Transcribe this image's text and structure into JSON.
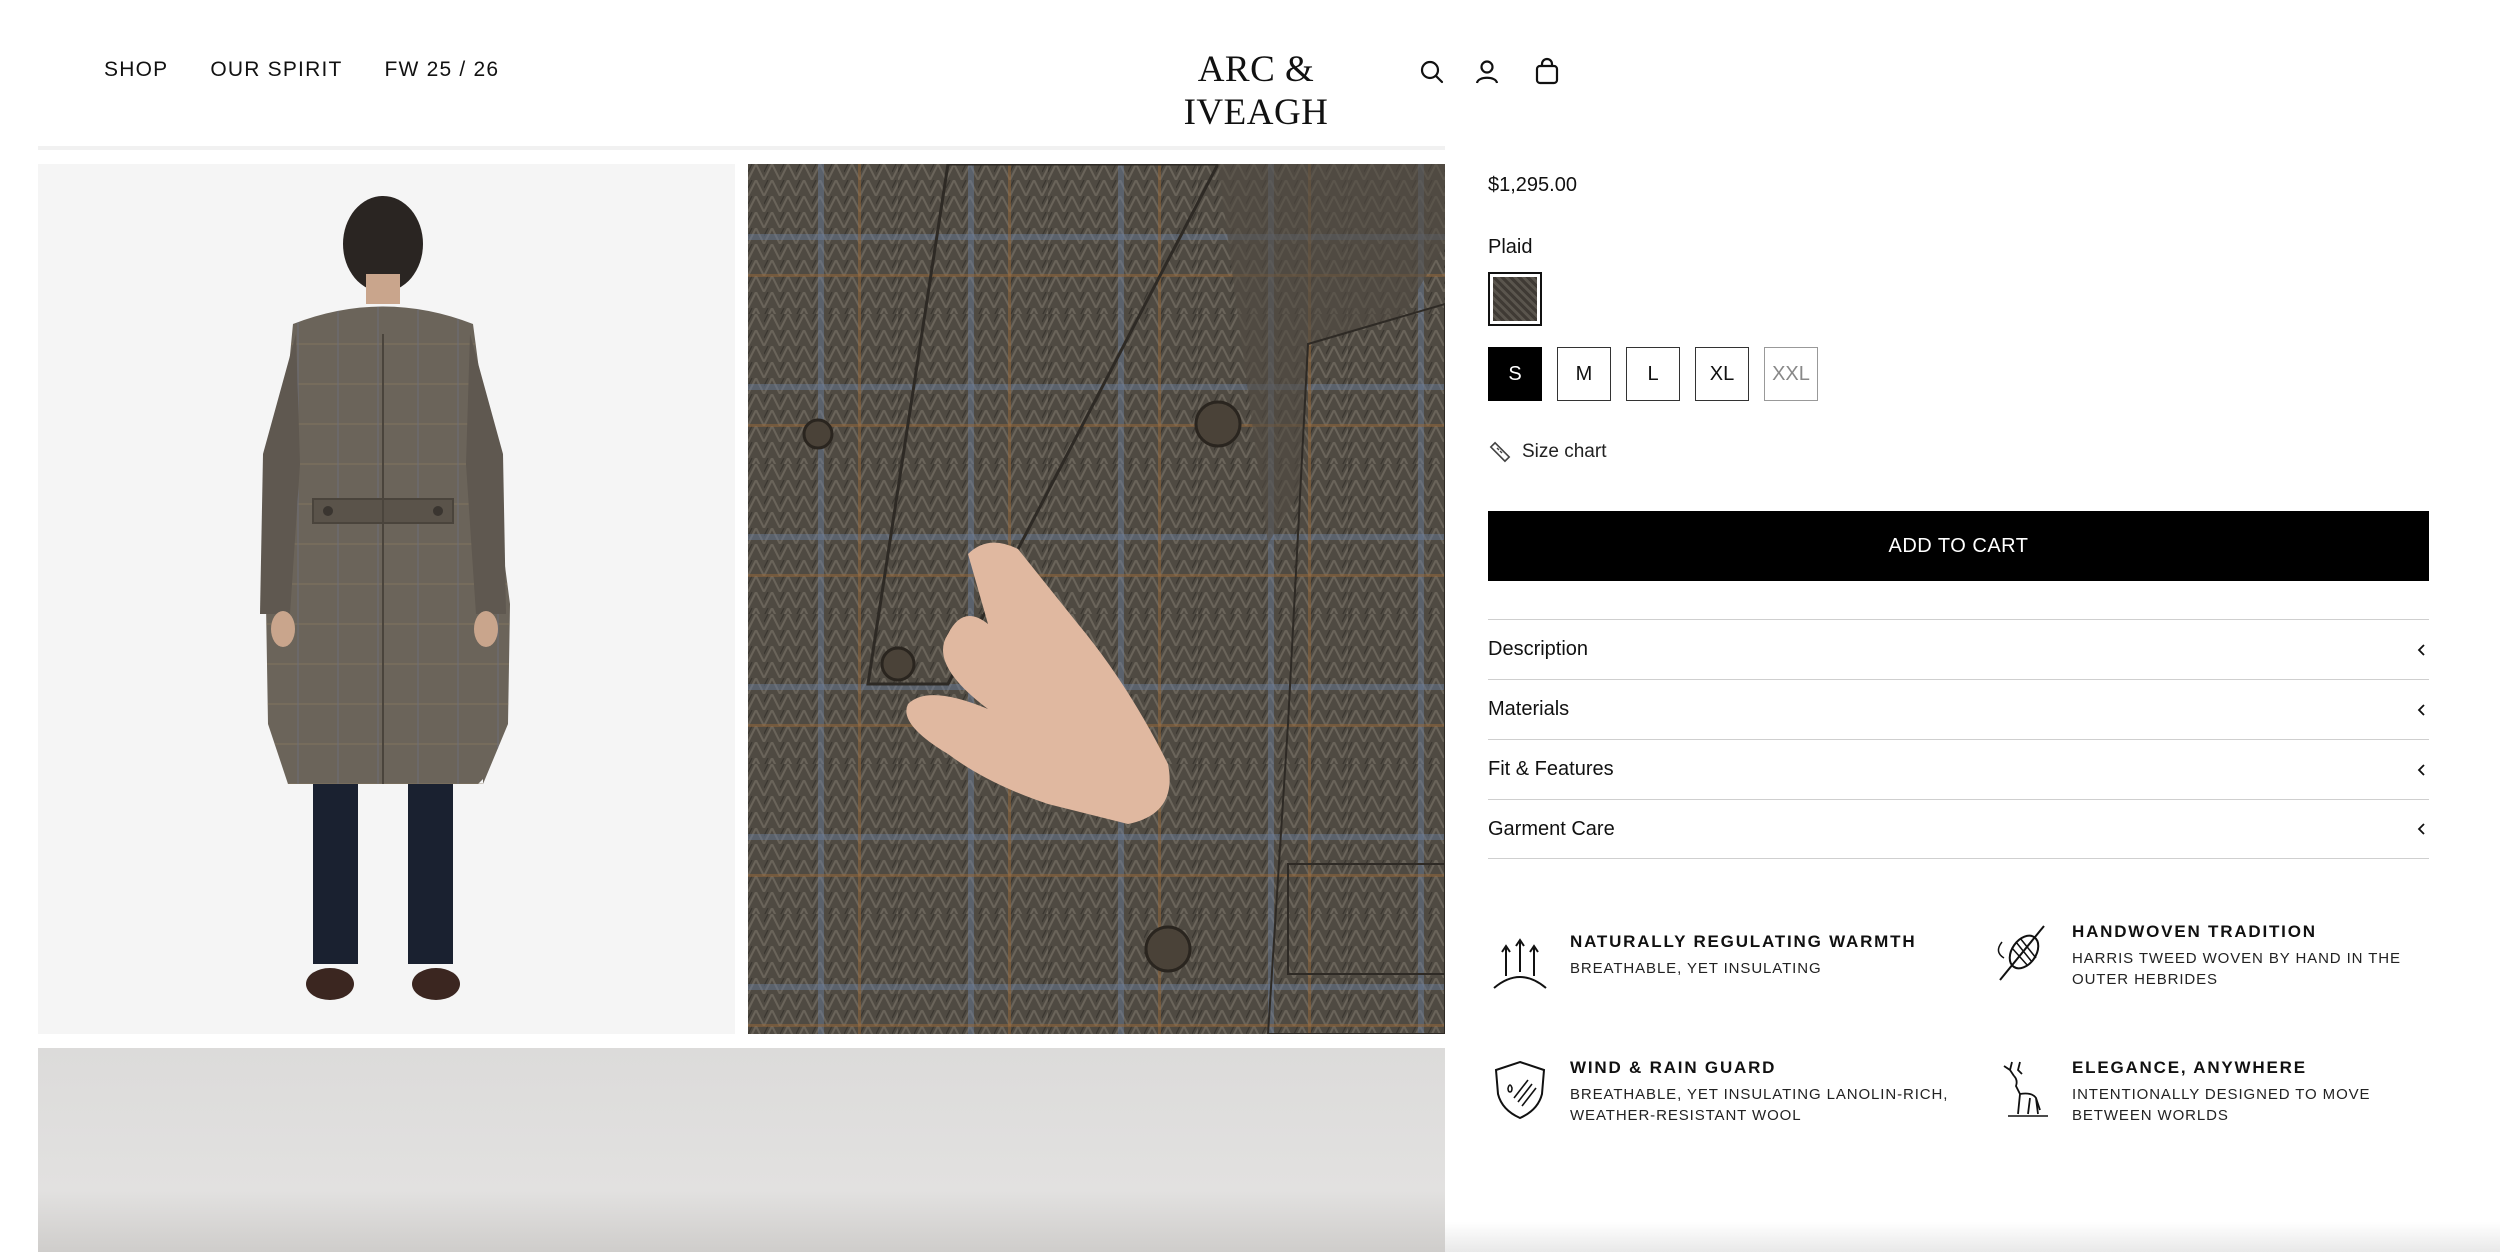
{
  "header": {
    "nav": [
      "SHOP",
      "OUR SPIRIT",
      "FW 25 / 26"
    ],
    "logo": "ARC & IVEAGH",
    "icons": [
      "search-icon",
      "account-icon",
      "cart-icon"
    ]
  },
  "gallery": {
    "images": [
      "coat-back-view",
      "coat-front-detail",
      "coat-lifestyle"
    ]
  },
  "product": {
    "price": "$1,295.00",
    "color_label": "Plaid",
    "sizes": [
      "S",
      "M",
      "L",
      "XL",
      "XXL"
    ],
    "selected_size": "S",
    "unavailable_sizes": [
      "XXL"
    ],
    "size_chart": "Size chart",
    "add_to_cart": "ADD TO CART",
    "accordion": [
      "Description",
      "Materials",
      "Fit & Features",
      "Garment Care"
    ]
  },
  "features": [
    {
      "icon": "warmth-icon",
      "title": "NATURALLY REGULATING WARMTH",
      "desc": [
        "BREATHABLE, YET INSULATING"
      ]
    },
    {
      "icon": "spindle-icon",
      "title": "HANDWOVEN TRADITION",
      "desc": [
        "HARRIS TWEED WOVEN BY HAND IN THE",
        "OUTER HEBRIDES"
      ]
    },
    {
      "icon": "shield-icon",
      "title": "WIND & RAIN GUARD",
      "desc": [
        "BREATHABLE, YET INSULATING LANOLIN-RICH,",
        "WEATHER-RESISTANT WOOL"
      ]
    },
    {
      "icon": "stag-icon",
      "title": "ELEGANCE, ANYWHERE",
      "desc": [
        "INTENTIONALLY DESIGNED TO MOVE",
        "BETWEEN WORLDS"
      ]
    }
  ],
  "colors": {
    "accent": "#000000",
    "text": "#111111",
    "divider": "#cfcfcf"
  }
}
